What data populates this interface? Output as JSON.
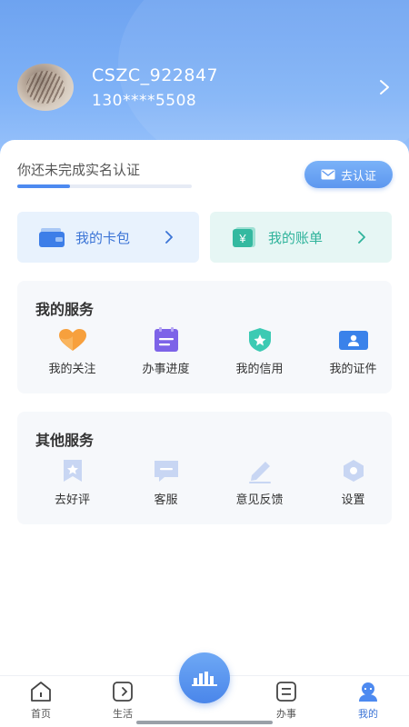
{
  "profile": {
    "username": "CSZC_922847",
    "phone": "130****5508"
  },
  "verification": {
    "text": "你还未完成实名认证",
    "button_label": "去认证",
    "progress": 0.3
  },
  "cards": {
    "wallet_label": "我的卡包",
    "bill_label": "我的账单"
  },
  "my_services": {
    "title": "我的服务",
    "items": [
      {
        "label": "我的关注",
        "icon": "heart-icon"
      },
      {
        "label": "办事进度",
        "icon": "calendar-icon"
      },
      {
        "label": "我的信用",
        "icon": "shield-star-icon"
      },
      {
        "label": "我的证件",
        "icon": "id-card-icon"
      }
    ]
  },
  "other_services": {
    "title": "其他服务",
    "items": [
      {
        "label": "去好评",
        "icon": "bookmark-star-icon"
      },
      {
        "label": "客服",
        "icon": "chat-icon"
      },
      {
        "label": "意见反馈",
        "icon": "pencil-icon"
      },
      {
        "label": "设置",
        "icon": "gear-icon"
      }
    ]
  },
  "tabbar": {
    "home": "首页",
    "life": "生活",
    "affairs": "办事",
    "mine": "我的"
  },
  "colors": {
    "accent": "#4d8af0",
    "wallet": "#3b74d6",
    "bill": "#2fb39b"
  }
}
